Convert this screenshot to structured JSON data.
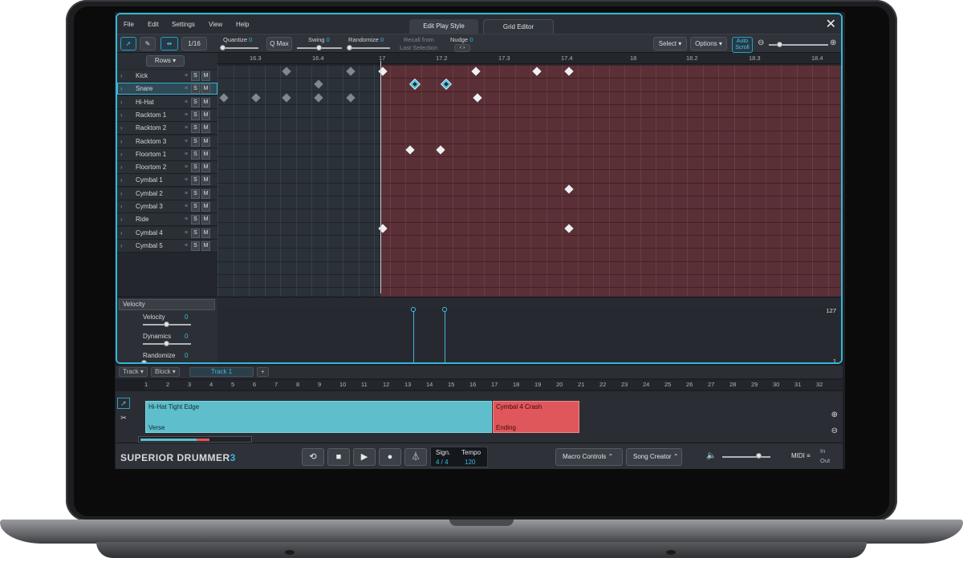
{
  "menu": [
    "File",
    "Edit",
    "Settings",
    "View",
    "Help"
  ],
  "tabs": {
    "edit_play_style": "Edit Play Style",
    "grid_editor": "Grid Editor"
  },
  "toolbar": {
    "grid": "1/16",
    "quantize_label": "Quantize",
    "quantize_value": "0",
    "qmax": "Q Max",
    "swing_label": "Swing",
    "swing_value": "0",
    "randomize_label": "Randomize",
    "randomize_value": "0",
    "recall_1": "Recall from",
    "recall_2": "Last Selection",
    "nudge_label": "Nudge",
    "nudge_value": "0",
    "select": "Select",
    "options": "Options",
    "auto_scroll_1": "Auto",
    "auto_scroll_2": "Scroll"
  },
  "ruler": [
    "16.3",
    "16.4",
    "17",
    "17.2",
    "17.3",
    "17.4",
    "18",
    "18.2",
    "18.3",
    "18.4"
  ],
  "rows_button": "Rows",
  "instruments": [
    "Kick",
    "Snare",
    "Hi-Hat",
    "Racktom 1",
    "Racktom 2",
    "Racktom 3",
    "Floortom 1",
    "Floortom 2",
    "Cymbal 1",
    "Cymbal 2",
    "Cymbal 3",
    "Ride",
    "Cymbal 4",
    "Cymbal 5"
  ],
  "solo": "S",
  "mute": "M",
  "velocity": {
    "select": "Velocity",
    "velocity_label": "Velocity",
    "velocity_value": "0",
    "dynamics_label": "Dynamics",
    "dynamics_value": "0",
    "randomize_label": "Randomize",
    "randomize_value": "0",
    "max": "127",
    "min": "1"
  },
  "song": {
    "track_pill": "Track",
    "block_pill": "Block",
    "track_name": "Track 1",
    "add": "+",
    "ruler": [
      "1",
      "2",
      "3",
      "4",
      "5",
      "6",
      "7",
      "8",
      "9",
      "10",
      "11",
      "12",
      "13",
      "14",
      "15",
      "16",
      "17",
      "18",
      "19",
      "20",
      "21",
      "22",
      "23",
      "24",
      "25",
      "26",
      "27",
      "28",
      "29",
      "30",
      "31",
      "32"
    ],
    "clip_blue_title": "Hi-Hat Tight Edge",
    "clip_blue_footer": "Verse",
    "clip_red_title": "Cymbal 4 Crash",
    "clip_red_footer": "Ending"
  },
  "transport": {
    "logo_main": "SUPERIOR DRUMMER",
    "logo_num": "3",
    "sign_label": "Sign.",
    "sign_value": "4 / 4",
    "tempo_label": "Tempo",
    "tempo_value": "120",
    "macro": "Macro Controls",
    "song_creator": "Song Creator",
    "midi": "MIDI",
    "in": "In",
    "out": "Out"
  },
  "colors": {
    "accent": "#35b5d8",
    "clip_blue": "#5fbecc",
    "clip_red": "#e0575b",
    "grid_red": "#5a2f35"
  }
}
